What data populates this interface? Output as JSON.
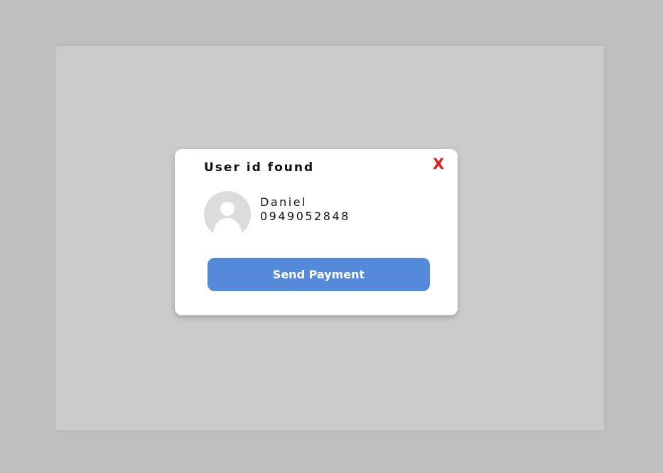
{
  "dialog": {
    "title": "User id found",
    "close_label": "X",
    "user": {
      "avatar_icon": "user-silhouette-icon",
      "name": "Daniel",
      "phone": "0949052848"
    },
    "action_label": "Send Payment"
  },
  "colors": {
    "page_background": "#bfbfbf",
    "overlay": "#cbcbcb",
    "dialog_background": "#ffffff",
    "close_red": "#e3191b",
    "button_blue": "#548ad9",
    "avatar_gray": "#dcdcdc"
  }
}
